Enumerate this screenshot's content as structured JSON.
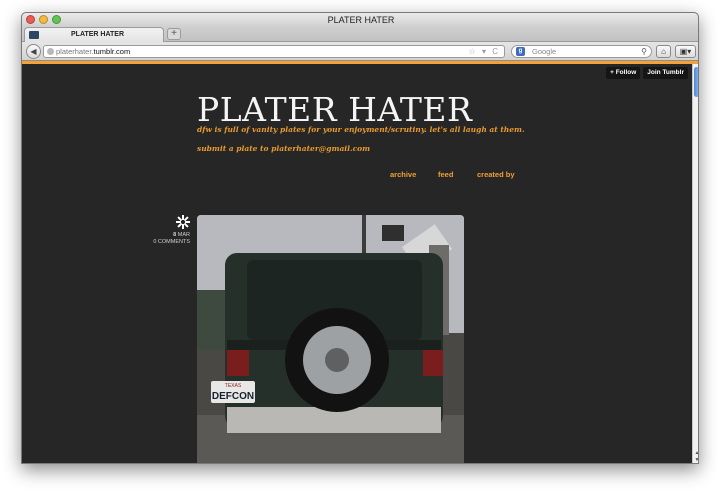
{
  "window": {
    "title": "PLATER HATER"
  },
  "tabs": [
    {
      "label": "PLATER HATER"
    }
  ],
  "toolbar": {
    "new_tab": "+",
    "back": "◀",
    "url_prefix": "platerhater.",
    "url_host": "tumblr.com",
    "url_icons": "☆ ▾ C",
    "search_placeholder": "Google",
    "home": "⌂",
    "tools": "▣▾"
  },
  "tumblr_controls": {
    "follow": "+ Follow",
    "join": "Join Tumblr"
  },
  "blog": {
    "title": "PLATER HATER",
    "tagline": "dfw is full of vanity plates for your enjoyment/scrutiny. let's all laugh at them.",
    "submit": "submit a plate to platerhater@gmail.com",
    "nav": [
      {
        "label": "archive"
      },
      {
        "label": "feed"
      },
      {
        "label": "created by"
      }
    ]
  },
  "post": {
    "day": "8",
    "month": "MAR",
    "comments": "0 COMMENTS",
    "plate_state": "TEXAS",
    "plate_text": "DEFCON"
  },
  "colors": {
    "accent": "#f0a033",
    "page_bg": "#262626",
    "title": "#f4f4f4"
  }
}
